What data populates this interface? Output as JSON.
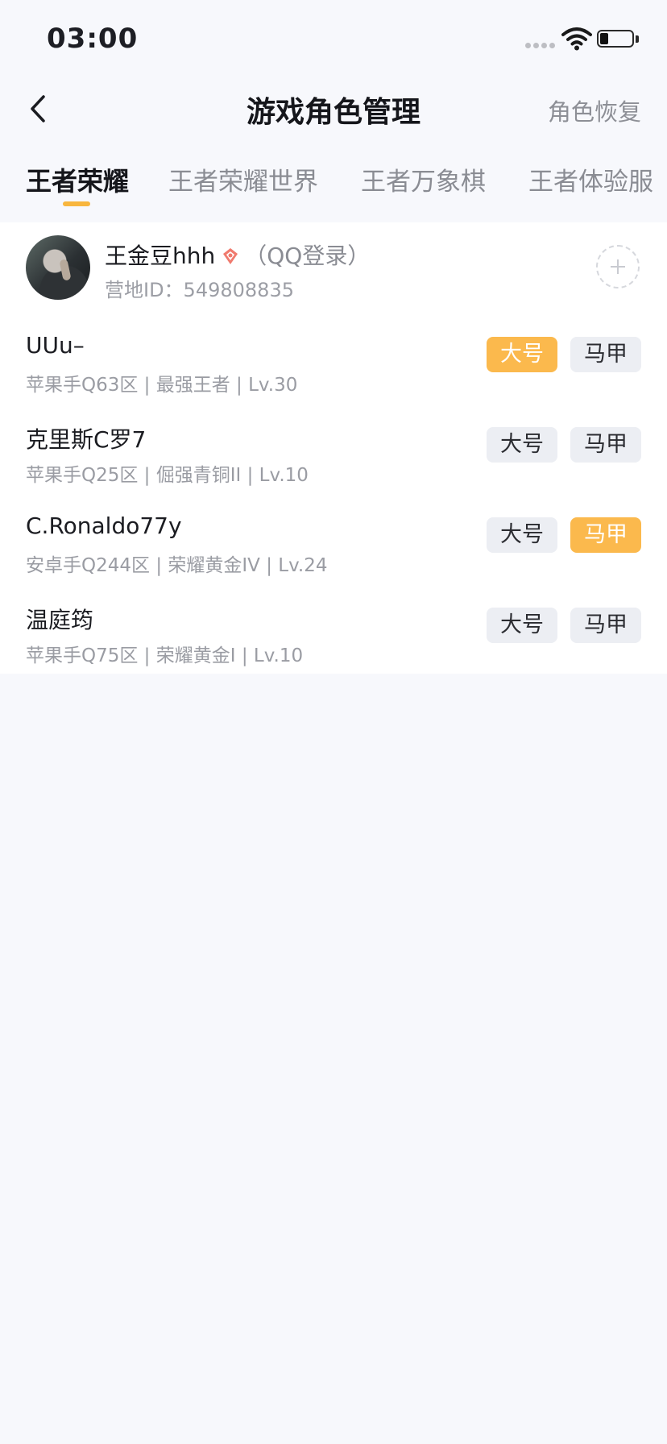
{
  "status_bar": {
    "time": "03:00"
  },
  "header": {
    "title": "游戏角色管理",
    "action": "角色恢复"
  },
  "tabs": [
    {
      "label": "王者荣耀",
      "active": true
    },
    {
      "label": "王者荣耀世界",
      "active": false
    },
    {
      "label": "王者万象棋",
      "active": false
    },
    {
      "label": "王者体验服",
      "active": false
    }
  ],
  "profile": {
    "name": "王金豆hhh",
    "login": "（QQ登录）",
    "camp_id": "营地ID：549808835"
  },
  "chip_labels": {
    "main": "大号",
    "alt": "马甲"
  },
  "roles": [
    {
      "name": "UUu–",
      "info": "苹果手Q63区 | 最强王者 | Lv.30",
      "selected": "main"
    },
    {
      "name": "克里斯C罗7",
      "info": "苹果手Q25区 | 倔强青铜II | Lv.10",
      "selected": "none"
    },
    {
      "name": "C.Ronaldo77y",
      "info": "安卓手Q244区 | 荣耀黄金IV | Lv.24",
      "selected": "alt"
    },
    {
      "name": "温庭筠",
      "info": "苹果手Q75区 | 荣耀黄金I | Lv.10",
      "selected": "none"
    }
  ],
  "colors": {
    "accent": "#fbb94d",
    "background": "#f7f8fc",
    "chip_inactive": "#eceef3"
  }
}
